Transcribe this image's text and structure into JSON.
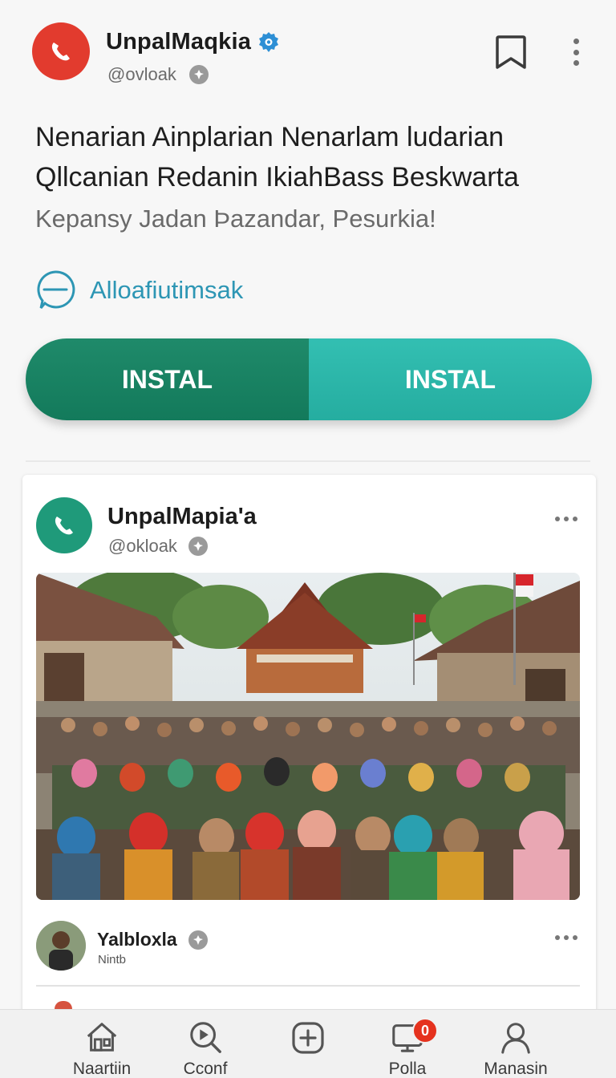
{
  "top_post": {
    "account_name": "UnpalMaqkia",
    "handle": "@ovloak",
    "lines": [
      "Nenarian Ainplarian Nenarlam ludarian",
      "Qllcanian Redanin IkiahBass Beskwarta"
    ],
    "subline": "Kepansy Jadan Þazandar, Pesurkia!",
    "link_text": "Alloafiutimsak",
    "install_left": "INSTAL",
    "install_right": "INSTAL"
  },
  "card": {
    "account_name": "UnpalMapia'a",
    "handle": "@okloak",
    "photo_alt": "Large crowd of villagers gathered in front of a traditional house",
    "comment": {
      "name": "Yalbloxla",
      "sub": "Nintb"
    }
  },
  "nav": {
    "items": [
      {
        "label": "Naartiin",
        "icon": "home-icon"
      },
      {
        "label": "Cconf",
        "icon": "play-search-icon"
      },
      {
        "label": "",
        "icon": "add-icon"
      },
      {
        "label": "Polla",
        "icon": "monitor-icon",
        "badge": "0"
      },
      {
        "label": "Manasin",
        "icon": "profile-icon"
      }
    ]
  },
  "colors": {
    "brand_red": "#e23b2e",
    "brand_green": "#1f9a7a",
    "install_dark": "#137a5b",
    "install_light": "#25ada0",
    "link_blue": "#2d96b4",
    "verified_blue": "#2d8fd5",
    "badge_red": "#e5321e"
  }
}
